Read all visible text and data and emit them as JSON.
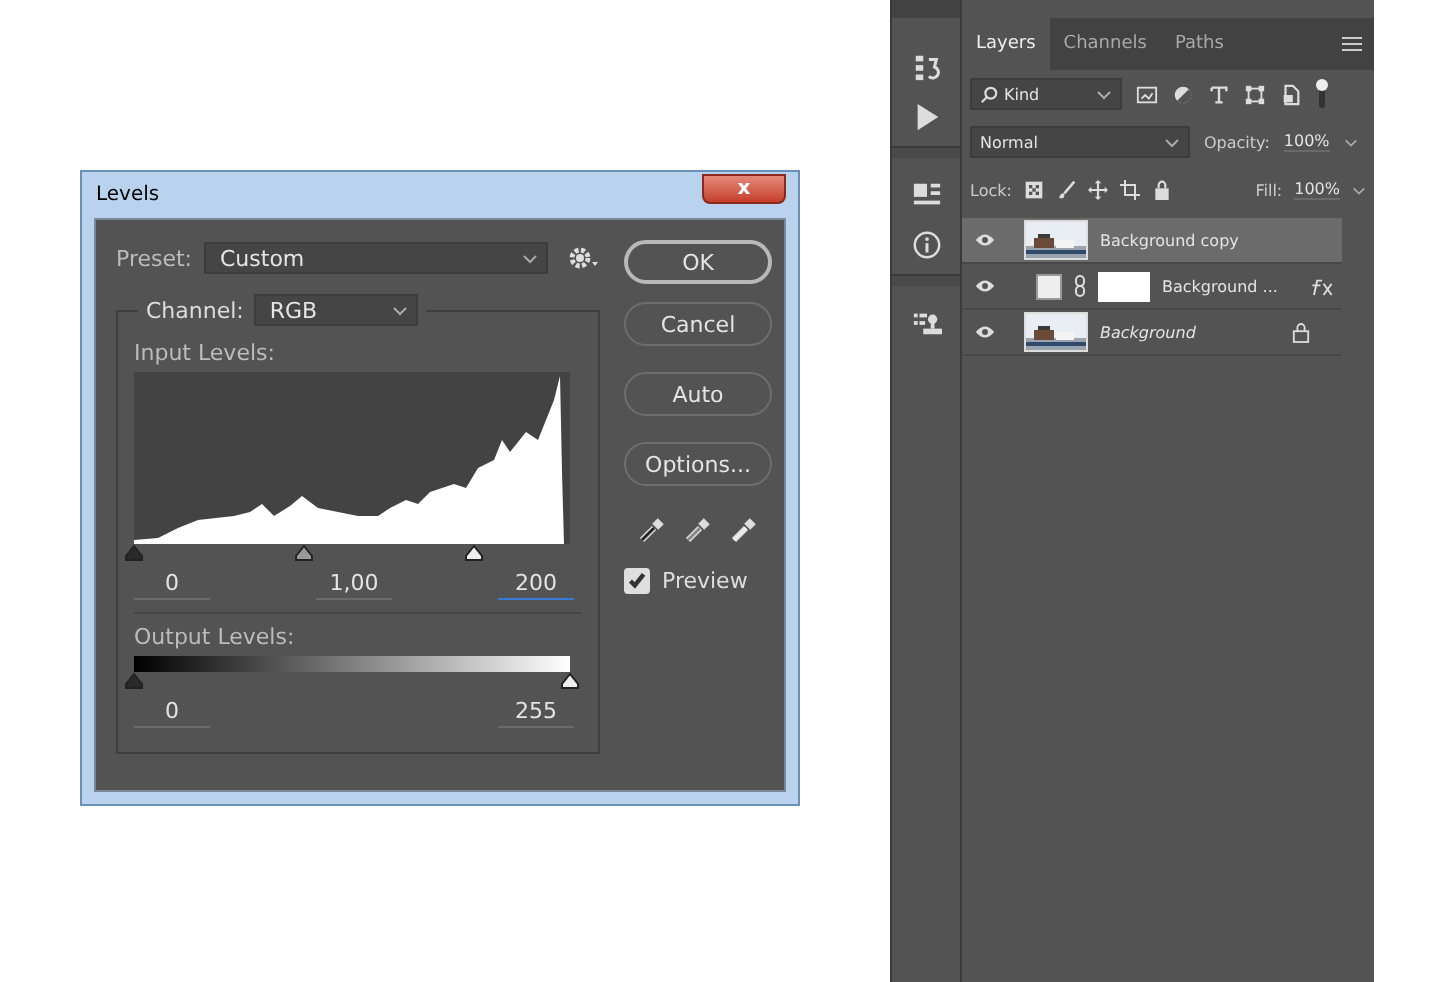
{
  "dialog": {
    "title": "Levels",
    "close": "x",
    "preset": {
      "label": "Preset:",
      "value": "Custom"
    },
    "channel": {
      "label": "Channel:",
      "value": "RGB"
    },
    "input_levels": {
      "label": "Input Levels:",
      "handles": [
        {
          "kind": "black",
          "level": 0
        },
        {
          "kind": "gray",
          "level": 0.39
        },
        {
          "kind": "white",
          "level": 0.78
        }
      ],
      "fields": [
        {
          "value": "0",
          "focused": false
        },
        {
          "value": "1,00",
          "focused": false
        },
        {
          "value": "200",
          "focused": true
        }
      ]
    },
    "output_levels": {
      "label": "Output Levels:",
      "handles": [
        {
          "kind": "black",
          "level": 0
        },
        {
          "kind": "white",
          "level": 1
        }
      ],
      "fields": [
        {
          "value": "0",
          "focused": false
        },
        {
          "value": "255",
          "focused": false
        }
      ]
    },
    "buttons": [
      {
        "label": "OK",
        "default": true
      },
      {
        "label": "Cancel",
        "default": false
      },
      {
        "label": "Auto",
        "default": false
      },
      {
        "label": "Options...",
        "default": false
      }
    ],
    "preview": {
      "label": "Preview",
      "checked": true
    }
  },
  "panel": {
    "tabs": [
      {
        "label": "Layers",
        "selected": true
      },
      {
        "label": "Channels",
        "selected": false
      },
      {
        "label": "Paths",
        "selected": false
      }
    ],
    "filter": {
      "value": "Kind"
    },
    "blend_mode": {
      "value": "Normal"
    },
    "opacity": {
      "label": "Opacity:",
      "value": "100%"
    },
    "lock": {
      "label": "Lock:"
    },
    "fill": {
      "label": "Fill:",
      "value": "100%"
    },
    "layers": [
      {
        "name": "Background copy",
        "selected": true,
        "visible": true,
        "italic": false,
        "locked": false,
        "fx": false
      },
      {
        "name": "Background ...",
        "kind": "adjustment",
        "selected": false,
        "visible": true,
        "italic": false,
        "locked": false,
        "fx": true
      },
      {
        "name": "Background",
        "selected": false,
        "visible": true,
        "italic": true,
        "locked": true,
        "fx": false
      }
    ]
  }
}
